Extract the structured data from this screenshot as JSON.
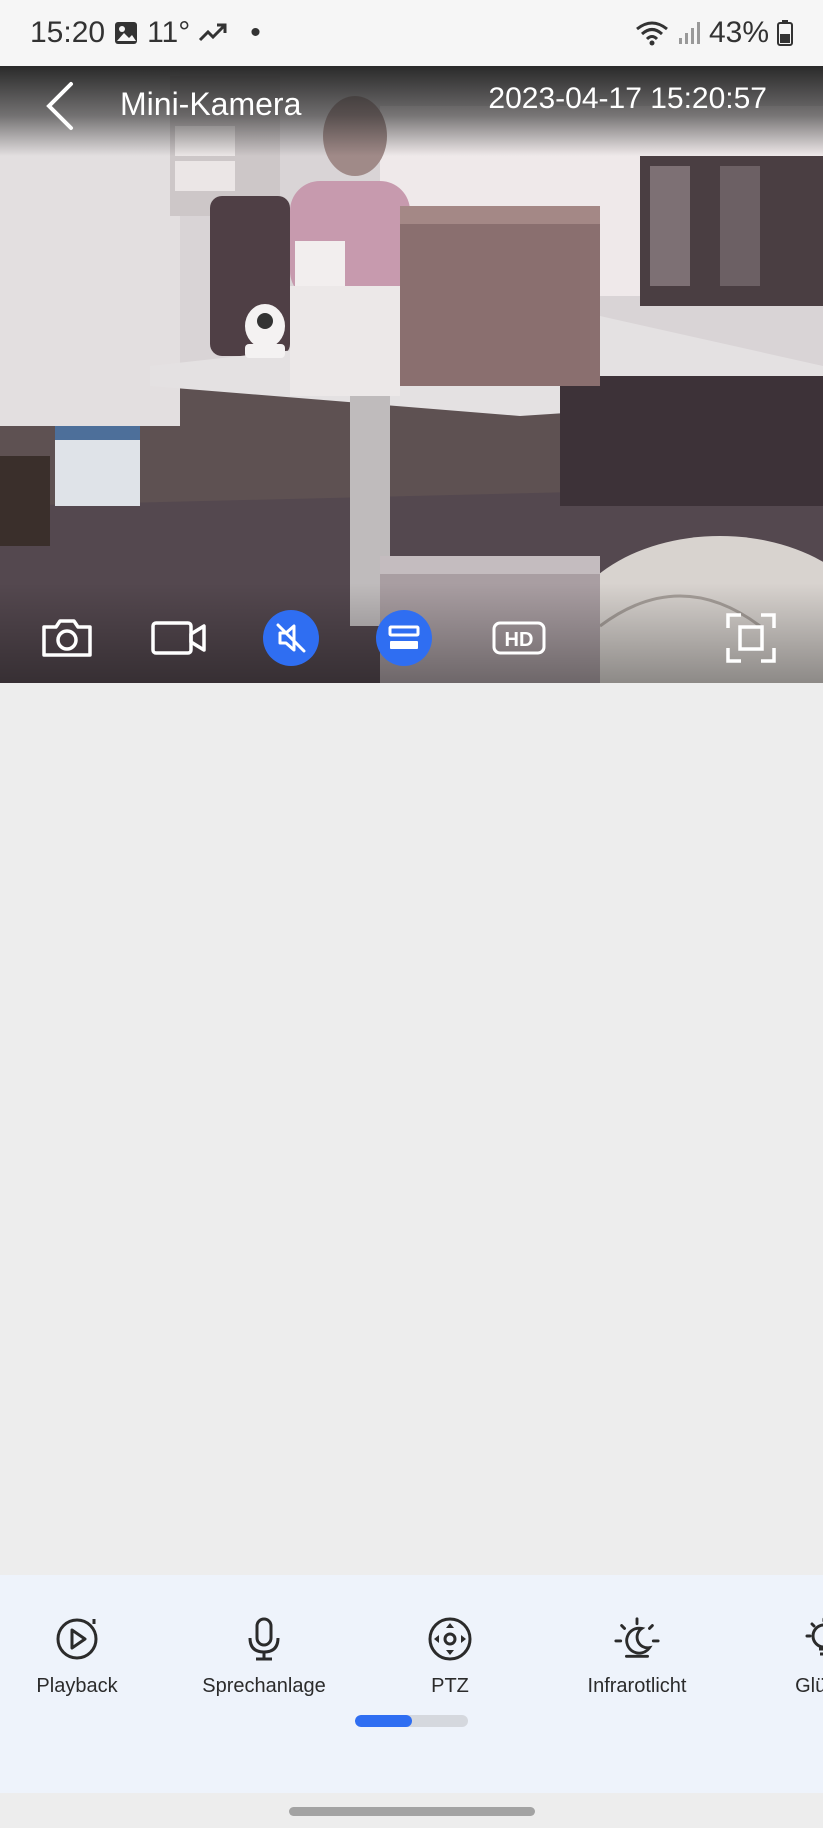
{
  "status_bar": {
    "time": "15:20",
    "temperature": "11°",
    "dot": "•",
    "battery": "43%",
    "icons": [
      "image-icon",
      "trending-icon",
      "wifi-icon",
      "signal-icon",
      "battery-icon"
    ]
  },
  "camera": {
    "title": "Mini-Kamera",
    "timestamp": "2023-04-17 15:20:57",
    "hd_label": "HD",
    "toolbar": [
      {
        "name": "screenshot",
        "icon": "camera-icon",
        "active": false
      },
      {
        "name": "record",
        "icon": "video-icon",
        "active": false
      },
      {
        "name": "mute",
        "icon": "speaker-muted-icon",
        "active": true
      },
      {
        "name": "flip",
        "icon": "flip-icon",
        "active": true
      },
      {
        "name": "quality",
        "icon": "hd-icon",
        "active": false
      },
      {
        "name": "fullscreen",
        "icon": "fullscreen-icon",
        "active": false
      }
    ]
  },
  "features": [
    {
      "label": "Playback",
      "icon": "playback-icon"
    },
    {
      "label": "Sprechanlage",
      "icon": "microphone-icon"
    },
    {
      "label": "PTZ",
      "icon": "ptz-icon"
    },
    {
      "label": "Infrarotlicht",
      "icon": "night-light-icon"
    },
    {
      "label": "Glühla",
      "icon": "bulb-icon"
    }
  ],
  "pager": {
    "page_fraction": 0.5
  },
  "colors": {
    "accent": "#2f6ef2",
    "background": "#ededed",
    "feature_bar": "#eef3fb"
  }
}
